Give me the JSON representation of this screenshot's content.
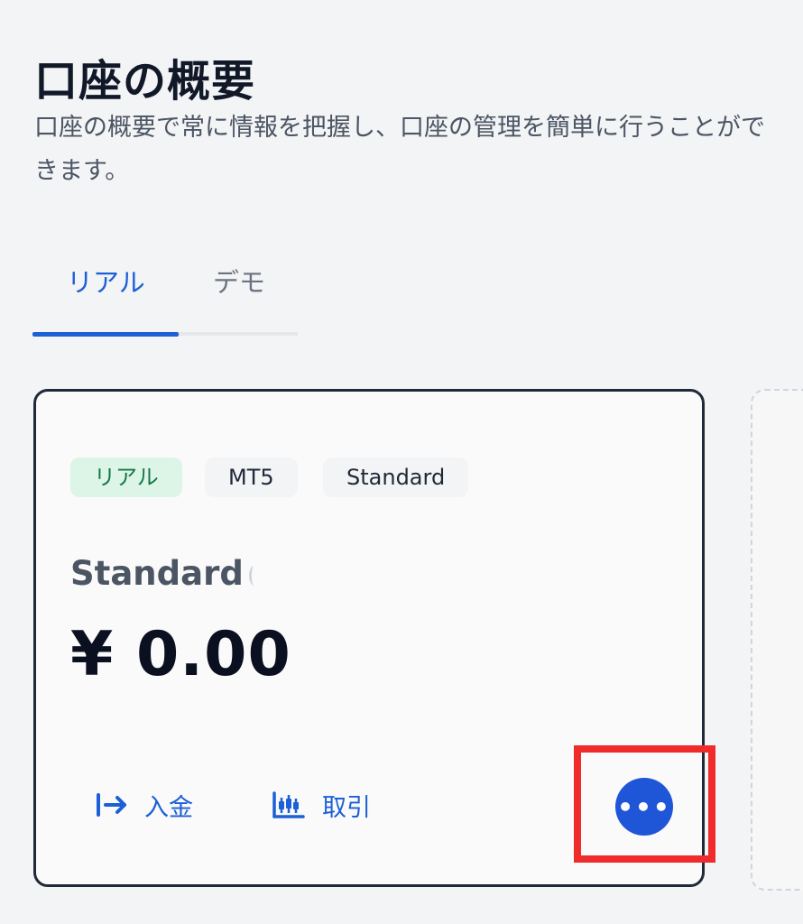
{
  "page": {
    "title": "口座の概要",
    "subtitle": "口座の概要で常に情報を把握し、口座の管理を簡単に行うことができます。"
  },
  "tabs": {
    "items": [
      {
        "label": "リアル",
        "active": true
      },
      {
        "label": "デモ",
        "active": false
      }
    ]
  },
  "account_card": {
    "badges": [
      "リアル",
      "MT5",
      "Standard"
    ],
    "name": "Standard",
    "balance": "¥ 0.00",
    "actions": {
      "deposit_label": "入金",
      "trade_label": "取引"
    },
    "more_button_label": "•••",
    "icons": {
      "deposit": "arrow-into-bar-icon",
      "trade": "candlestick-chart-icon",
      "more": "more-horizontal-icon"
    }
  },
  "colors": {
    "accent": "#1d5fd6",
    "more_button": "#1f56d8",
    "highlight": "#ef2b2b",
    "badge_real_bg": "#dcf5e6",
    "badge_real_text": "#157a45"
  }
}
